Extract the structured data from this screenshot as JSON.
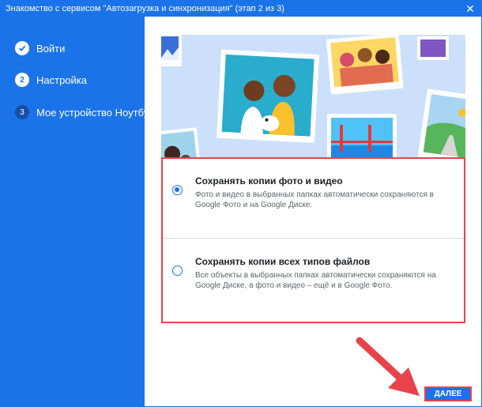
{
  "window": {
    "title": "Знакомство с сервисом \"Автозагрузка и синхронизация\" (этап 2 из 3)",
    "close_glyph": "✕"
  },
  "sidebar": {
    "steps": [
      {
        "badge": "",
        "label": "Войти",
        "state": "done"
      },
      {
        "badge": "2",
        "label": "Настройка",
        "state": "current"
      },
      {
        "badge": "3",
        "label": "Мое устройство Ноутбук",
        "state": "pending"
      }
    ]
  },
  "options": [
    {
      "title": "Сохранять копии фото и видео",
      "description": "Фото и видео в выбранных папках автоматически сохраняются в Google Фото и на Google Диске.",
      "selected": true
    },
    {
      "title": "Сохранять копии всех типов файлов",
      "description": "Все объекты в выбранных папках автоматически сохраняются на Google Диске, а фото и видео – ещё и в Google Фото.",
      "selected": false
    }
  ],
  "footer": {
    "next_label": "ДАЛЕЕ"
  },
  "colors": {
    "accent": "#1a73e8",
    "highlight": "#e8424a",
    "hero_background": "#cce0fb"
  },
  "icons": [
    "close-icon",
    "check-icon",
    "arrow-annotation-icon"
  ]
}
